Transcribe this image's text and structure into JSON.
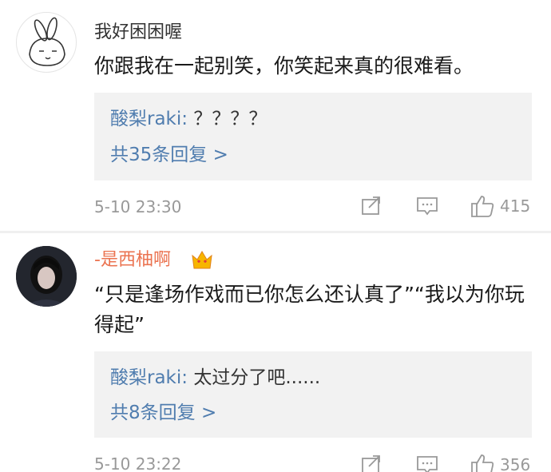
{
  "comments": [
    {
      "username": "我好困困喔",
      "text": "你跟我在一起别笑，你笑起来真的很难看。",
      "reply": {
        "author": "酸梨raki:",
        "text": " ？？？？"
      },
      "reply_count": "共35条回复 >",
      "time": "5-10 23:30",
      "likes": "415"
    },
    {
      "username": "-是西柚啊",
      "text": "“只是逢场作戏而已你怎么还认真了”“我以为你玩得起”",
      "reply": {
        "author": "酸梨raki:",
        "text": " 太过分了吧......"
      },
      "reply_count": "共8条回复 >",
      "time": "5-10 23:22",
      "likes": "356"
    }
  ],
  "colors": {
    "link": "#507daf",
    "vip_name": "#eb7350",
    "meta": "#999999",
    "reply_bg": "#f2f2f2"
  },
  "icons": [
    "repost-icon",
    "comment-icon",
    "like-icon",
    "vip-crown-icon"
  ]
}
